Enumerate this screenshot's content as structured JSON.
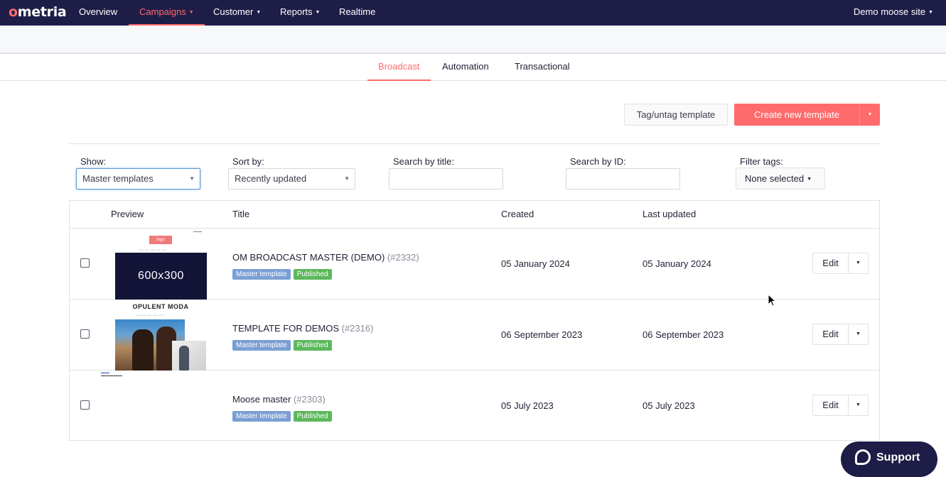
{
  "topnav": {
    "logo_prefix": "o",
    "logo_rest": "metria",
    "items": [
      {
        "label": "Overview"
      },
      {
        "label": "Campaigns"
      },
      {
        "label": "Customer"
      },
      {
        "label": "Reports"
      },
      {
        "label": "Realtime"
      }
    ],
    "site": "Demo moose site"
  },
  "subtabs": [
    {
      "label": "Broadcast"
    },
    {
      "label": "Automation"
    },
    {
      "label": "Transactional"
    }
  ],
  "actions": {
    "tag_label": "Tag/untag template",
    "create_label": "Create new template"
  },
  "filters": {
    "show_label": "Show:",
    "show_value": "Master templates",
    "sort_label": "Sort by:",
    "sort_value": "Recently updated",
    "search_title_label": "Search by title:",
    "search_id_label": "Search by ID:",
    "tags_label": "Filter tags:",
    "tags_value": "None selected"
  },
  "table": {
    "headers": {
      "preview": "Preview",
      "title": "Title",
      "created": "Created",
      "updated": "Last updated"
    },
    "rows": [
      {
        "title": "OM BROADCAST MASTER (DEMO)",
        "id": "(#2332)",
        "badge_master": "Master template",
        "badge_status": "Published",
        "created": "05 January 2024",
        "updated": "05 January 2024",
        "edit": "Edit",
        "preview": {
          "logo": "logo",
          "hero": "600x300"
        }
      },
      {
        "title": "TEMPLATE FOR DEMOS",
        "id": "(#2316)",
        "badge_master": "Master template",
        "badge_status": "Published",
        "created": "06 September 2023",
        "updated": "06 September 2023",
        "edit": "Edit",
        "preview": {
          "brand": "OPULENT MODA"
        }
      },
      {
        "title": "Moose master",
        "id": "(#2303)",
        "badge_master": "Master template",
        "badge_status": "Published",
        "created": "05 July 2023",
        "updated": "05 July 2023",
        "edit": "Edit",
        "preview": {}
      }
    ]
  },
  "support": {
    "label": "Support"
  },
  "colors": {
    "nav_bg": "#1e1d47",
    "accent": "#ff6b6b",
    "badge_master": "#7a9fd4",
    "badge_published": "#5cb85c"
  }
}
